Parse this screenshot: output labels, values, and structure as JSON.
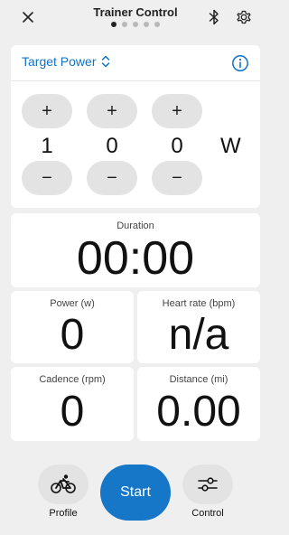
{
  "header": {
    "title": "Trainer Control",
    "page_count": 5,
    "active_page": 1
  },
  "target": {
    "label": "Target Power",
    "digits": [
      "1",
      "0",
      "0"
    ],
    "unit": "W",
    "plus_glyph": "+",
    "minus_glyph": "−"
  },
  "metrics": {
    "duration": {
      "label": "Duration",
      "value": "00:00"
    },
    "power": {
      "label": "Power (w)",
      "value": "0"
    },
    "heart_rate": {
      "label": "Heart rate (bpm)",
      "value": "n/a"
    },
    "cadence": {
      "label": "Cadence (rpm)",
      "value": "0"
    },
    "distance": {
      "label": "Distance (mi)",
      "value": "0.00"
    }
  },
  "bottom_bar": {
    "profile_label": "Profile",
    "start_label": "Start",
    "control_label": "Control"
  },
  "colors": {
    "accent": "#1677c9",
    "background": "#efefef",
    "card": "#ffffff",
    "pill": "#e3e3e3"
  },
  "icons": [
    "close-icon",
    "bluetooth-icon",
    "gear-icon",
    "up-down-chevron-icon",
    "info-icon",
    "cyclist-icon",
    "sliders-icon"
  ]
}
